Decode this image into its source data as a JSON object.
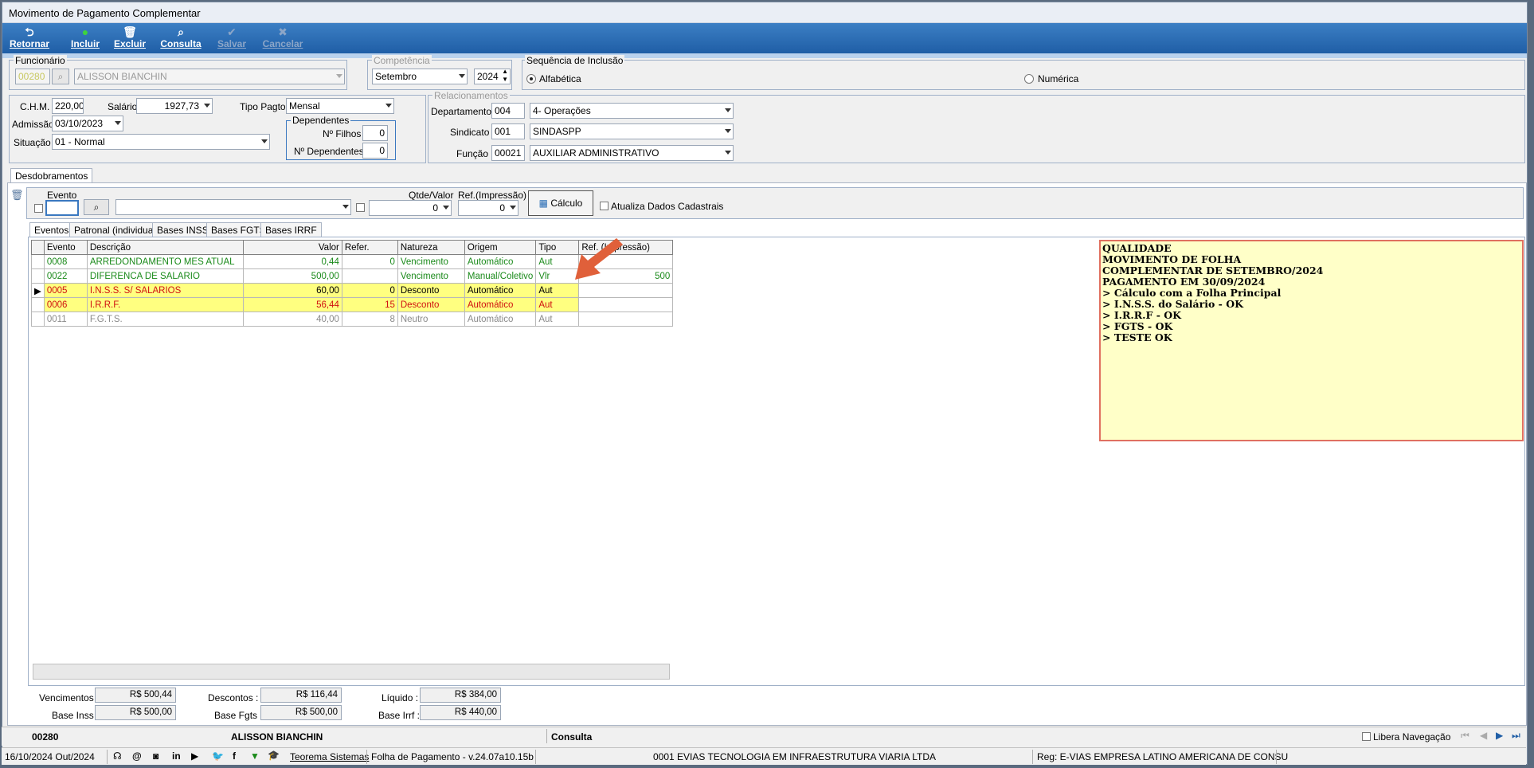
{
  "window": {
    "title": "Movimento de Pagamento Complementar"
  },
  "toolbar": {
    "retornar": "Retornar",
    "incluir": "Incluir",
    "excluir": "Excluir",
    "consulta": "Consulta",
    "salvar": "Salvar",
    "cancelar": "Cancelar"
  },
  "funcionario": {
    "label": "Funcionário",
    "code": "00280",
    "name": "ALISSON BIANCHIN"
  },
  "competencia": {
    "label": "Competência",
    "month": "Setembro",
    "year": "2024"
  },
  "sequencia": {
    "label": "Sequência de Inclusão",
    "opt1": "Alfabética",
    "opt2": "Numérica"
  },
  "dados": {
    "chm_label": "C.H.M.",
    "chm": "220,00",
    "salario_label": "Salário",
    "salario": "1927,73",
    "tipo_pagto_label": "Tipo Pagto",
    "tipo_pagto": "Mensal",
    "admissao_label": "Admissão",
    "admissao": "03/10/2023",
    "situacao_label": "Situação",
    "situacao": "01 - Normal",
    "dependentes_label": "Dependentes",
    "nfilhos_label": "Nº Filhos",
    "nfilhos": "0",
    "ndep_label": "Nº Dependentes",
    "ndep": "0"
  },
  "relacionamentos": {
    "label": "Relacionamentos",
    "depto_label": "Departamento",
    "depto_code": "004",
    "depto_name": "4- Operações",
    "sind_label": "Sindicato",
    "sind_code": "001",
    "sind_name": "SINDASPP",
    "func_label": "Função",
    "func_code": "00021",
    "func_name": "AUXILIAR ADMINISTRATIVO"
  },
  "tabs_main": {
    "desdobramentos": "Desdobramentos"
  },
  "evento_bar": {
    "evento_label": "Evento",
    "qtde_label": "Qtde/Valor",
    "qtde": "0",
    "ref_label": "Ref.(Impressão)",
    "ref": "0",
    "calculo": "Cálculo",
    "atualiza": "Atualiza Dados Cadastrais"
  },
  "tabs_sub": [
    "Eventos",
    "Patronal (individual)",
    "Bases INSS",
    "Bases FGTS",
    "Bases IRRF"
  ],
  "grid": {
    "headers": [
      "Evento",
      "Descrição",
      "Valor",
      "Refer.",
      "Natureza",
      "Origem",
      "Tipo",
      "Ref. (Impressão)"
    ],
    "rows": [
      [
        "0008",
        "ARREDONDAMENTO MES ATUAL",
        "0,44",
        "0",
        "Vencimento",
        "Automático",
        "Aut",
        ""
      ],
      [
        "0022",
        "DIFERENCA DE SALARIO",
        "500,00",
        "",
        "Vencimento",
        "Manual/Coletivo",
        "Vlr",
        "500"
      ],
      [
        "0005",
        "I.N.S.S. S/ SALARIOS",
        "60,00",
        "0",
        "Desconto",
        "Automático",
        "Aut",
        ""
      ],
      [
        "0006",
        "I.R.R.F.",
        "56,44",
        "15",
        "Desconto",
        "Automático",
        "Aut",
        ""
      ],
      [
        "0011",
        "F.G.T.S.",
        "40,00",
        "8",
        "Neutro",
        "Automático",
        "Aut",
        ""
      ]
    ]
  },
  "note": [
    "QUALIDADE",
    "MOVIMENTO DE FOLHA",
    "COMPLEMENTAR DE SETEMBRO/2024",
    "",
    "PAGAMENTO EM 30/09/2024",
    "",
    "> Cálculo com a Folha Principal",
    "",
    "> I.N.S.S. do Salário - OK",
    "",
    "> I.R.R.F - OK",
    "",
    "> FGTS - OK",
    "",
    "> TESTE OK"
  ],
  "totais": {
    "venc_label": "Vencimentos :",
    "venc": "R$ 500,44",
    "desc_label": "Descontos :",
    "desc": "R$ 116,44",
    "liq_label": "Líquido :",
    "liq": "R$ 384,00",
    "binss_label": "Base Inss :",
    "binss": "R$ 500,00",
    "bfgts_label": "Base Fgts :",
    "bfgts": "R$ 500,00",
    "birrf_label": "Base Irrf :",
    "birrf": "R$ 440,00"
  },
  "statusbar": {
    "code": "00280",
    "name": "ALISSON BIANCHIN",
    "mode": "Consulta",
    "libera": "Libera Navegação"
  },
  "footer": {
    "date": "16/10/2024 Out/2024",
    "teorema": "Teorema Sistemas",
    "version": "Folha de Pagamento - v.24.07a10.15b",
    "company": "0001 EVIAS TECNOLOGIA EM INFRAESTRUTURA VIARIA LTDA",
    "reg": "Reg: E-VIAS EMPRESA LATINO AMERICANA DE CONSU"
  },
  "colors": {
    "toolbar": "#2a6db5",
    "highlight": "#ffff80",
    "note_bg": "#ffffc8",
    "arrow": "#e0603a"
  }
}
